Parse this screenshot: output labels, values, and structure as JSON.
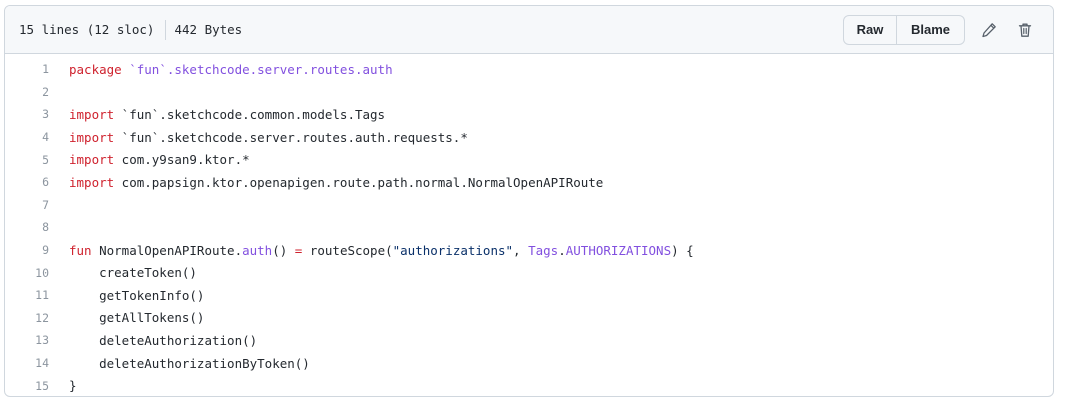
{
  "header": {
    "lines_info": "15 lines (12 sloc)",
    "size": "442 Bytes",
    "raw_label": "Raw",
    "blame_label": "Blame",
    "edit_icon": "pencil-icon",
    "delete_icon": "trash-icon"
  },
  "colors": {
    "keyword": "#cf222e",
    "entity": "#8250df",
    "string": "#0a3069",
    "line_number": "#8c959f"
  },
  "code": [
    {
      "num": "1",
      "tokens": [
        {
          "t": "package",
          "c": "kw"
        },
        {
          "t": " `fun`.sketchcode.server.routes.auth",
          "c": "pl"
        }
      ]
    },
    {
      "num": "2",
      "tokens": []
    },
    {
      "num": "3",
      "tokens": [
        {
          "t": "import",
          "c": "kw"
        },
        {
          "t": " `fun`.sketchcode.common.models.Tags",
          "c": ""
        }
      ]
    },
    {
      "num": "4",
      "tokens": [
        {
          "t": "import",
          "c": "kw"
        },
        {
          "t": " `fun`.sketchcode.server.routes.auth.requests.*",
          "c": ""
        }
      ]
    },
    {
      "num": "5",
      "tokens": [
        {
          "t": "import",
          "c": "kw"
        },
        {
          "t": " com.y9san9.ktor.*",
          "c": ""
        }
      ]
    },
    {
      "num": "6",
      "tokens": [
        {
          "t": "import",
          "c": "kw"
        },
        {
          "t": " com.papsign.ktor.openapigen.route.path.normal.NormalOpenAPIRoute",
          "c": ""
        }
      ]
    },
    {
      "num": "7",
      "tokens": []
    },
    {
      "num": "8",
      "tokens": []
    },
    {
      "num": "9",
      "tokens": [
        {
          "t": "fun",
          "c": "kw"
        },
        {
          "t": " NormalOpenAPIRoute.",
          "c": ""
        },
        {
          "t": "auth",
          "c": "pl"
        },
        {
          "t": "() ",
          "c": ""
        },
        {
          "t": "=",
          "c": "kw"
        },
        {
          "t": " routeScope(",
          "c": ""
        },
        {
          "t": "\"authorizations\"",
          "c": "str"
        },
        {
          "t": ", ",
          "c": ""
        },
        {
          "t": "Tags",
          "c": "pl"
        },
        {
          "t": ".",
          "c": ""
        },
        {
          "t": "AUTHORIZATIONS",
          "c": "pl"
        },
        {
          "t": ") {",
          "c": ""
        }
      ]
    },
    {
      "num": "10",
      "tokens": [
        {
          "t": "    createToken()",
          "c": ""
        }
      ]
    },
    {
      "num": "11",
      "tokens": [
        {
          "t": "    getTokenInfo()",
          "c": ""
        }
      ]
    },
    {
      "num": "12",
      "tokens": [
        {
          "t": "    getAllTokens()",
          "c": ""
        }
      ]
    },
    {
      "num": "13",
      "tokens": [
        {
          "t": "    deleteAuthorization()",
          "c": ""
        }
      ]
    },
    {
      "num": "14",
      "tokens": [
        {
          "t": "    deleteAuthorizationByToken()",
          "c": ""
        }
      ]
    },
    {
      "num": "15",
      "tokens": [
        {
          "t": "}",
          "c": ""
        }
      ]
    }
  ]
}
